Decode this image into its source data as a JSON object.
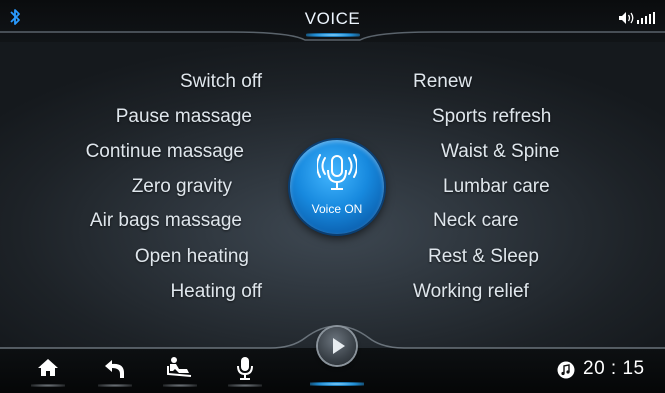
{
  "header": {
    "title": "VOICE",
    "bluetooth_icon": "bluetooth-icon",
    "volume_icon": "volume-signal-icon"
  },
  "commands": {
    "left": [
      "Switch off",
      "Pause massage",
      "Continue massage",
      "Zero gravity",
      "Air  bags massage",
      "Open heating",
      "Heating off"
    ],
    "right": [
      "Renew",
      "Sports refresh",
      "Waist & Spine",
      "Lumbar care",
      "Neck care",
      "Rest & Sleep",
      "Working relief"
    ]
  },
  "voice_button": {
    "label": "Voice ON",
    "icon": "microphone-icon"
  },
  "bottom_nav": {
    "buttons": [
      "home-icon",
      "back-icon",
      "massage-chair-icon",
      "microphone-icon"
    ],
    "play_icon": "play-icon"
  },
  "status": {
    "music_icon": "music-note-icon",
    "time": "20 : 15"
  },
  "colors": {
    "accent": "#1b8fe0",
    "text": "#dfe6ec",
    "background": "#252b31"
  }
}
